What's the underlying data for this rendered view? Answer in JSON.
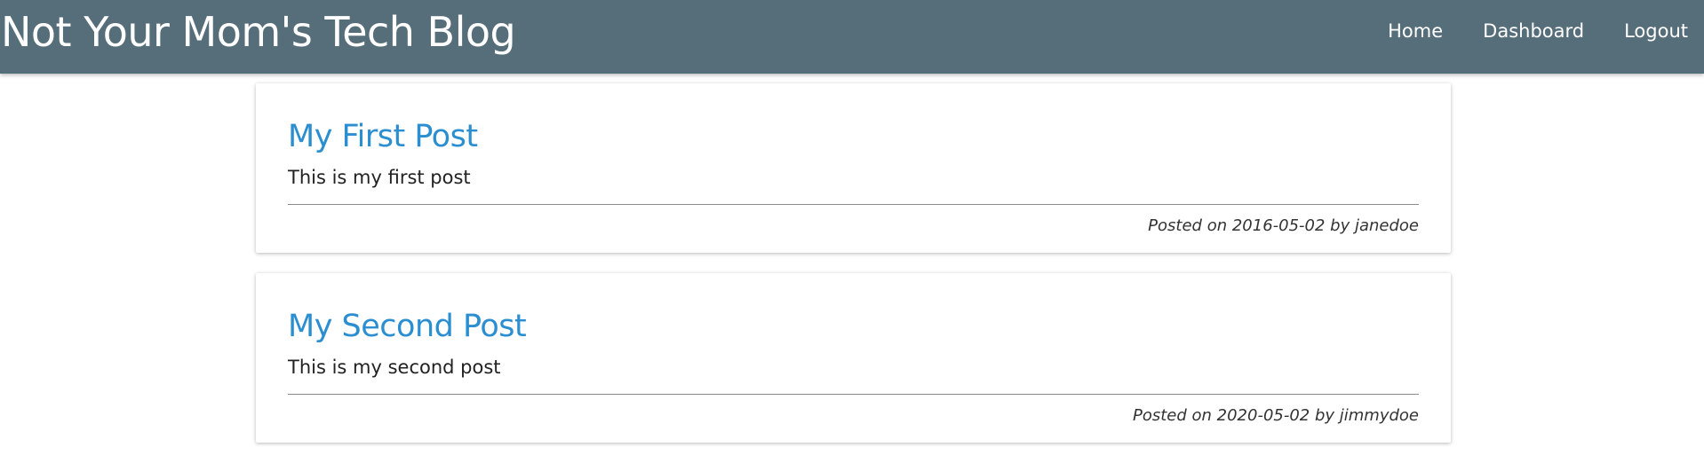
{
  "header": {
    "brand": "Not Your Mom's Tech Blog",
    "nav": [
      {
        "label": "Home"
      },
      {
        "label": "Dashboard"
      },
      {
        "label": "Logout"
      }
    ]
  },
  "posts": [
    {
      "title": "My First Post",
      "body": "This is my first post",
      "meta": "Posted on 2016-05-02 by janedoe"
    },
    {
      "title": "My Second Post",
      "body": "This is my second post",
      "meta": "Posted on 2020-05-02 by jimmydoe"
    }
  ],
  "colors": {
    "navbar": "#566e7a",
    "post_title": "#2a8ed0",
    "text": "#222222"
  }
}
